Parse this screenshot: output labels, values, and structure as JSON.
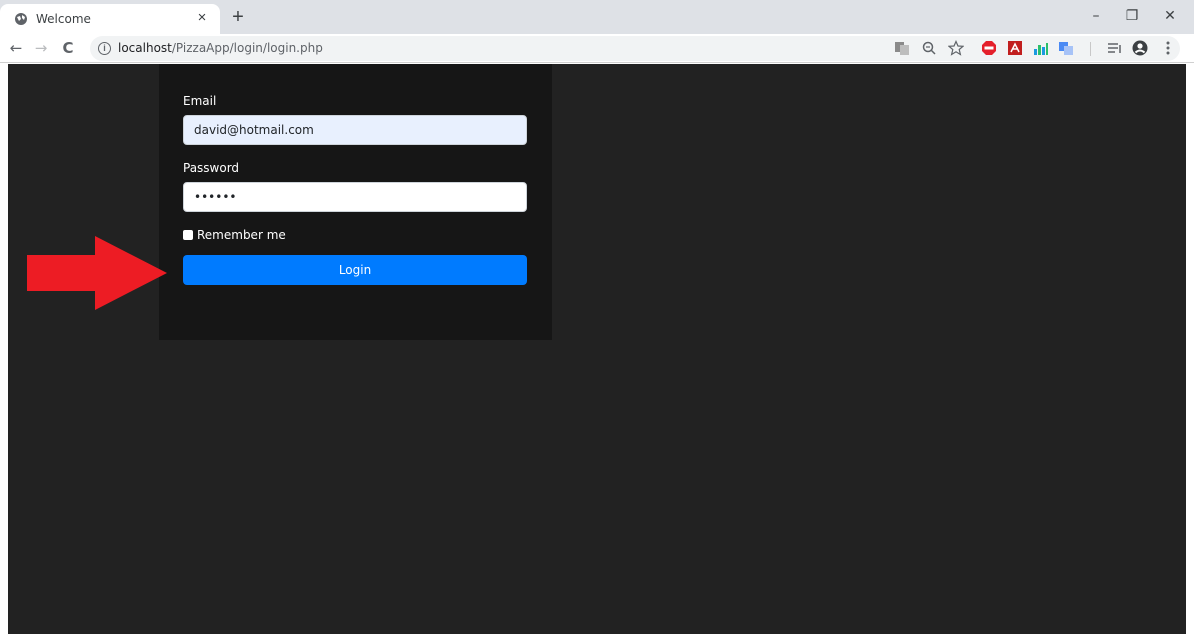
{
  "browser": {
    "tab_title": "Welcome",
    "tab_close": "×",
    "new_tab": "+",
    "window_controls": {
      "minimize": "–",
      "restore": "❐",
      "close": "✕"
    },
    "nav": {
      "back": "←",
      "forward": "→",
      "reload": "C"
    },
    "url_host": "localhost",
    "url_path": "/PizzaApp/login/login.php",
    "info_icon": "i",
    "toolbar_icons": [
      "translate-icon",
      "zoom-icon",
      "bookmark-star-icon",
      "adblock-plus-icon",
      "acrobat-icon",
      "extension-bars-icon",
      "extension-translate-icon",
      "reading-list-icon",
      "profile-icon",
      "menu-icon"
    ]
  },
  "login": {
    "email_label": "Email",
    "email_value": "david@hotmail.com",
    "password_label": "Password",
    "password_value": "••••••",
    "remember_label": "Remember me",
    "login_button": "Login"
  },
  "colors": {
    "page_bg": "#222222",
    "panel_bg": "#161616",
    "button_bg": "#007bff",
    "autofill_bg": "#e8f0fe",
    "arrow": "#ed1c24"
  }
}
